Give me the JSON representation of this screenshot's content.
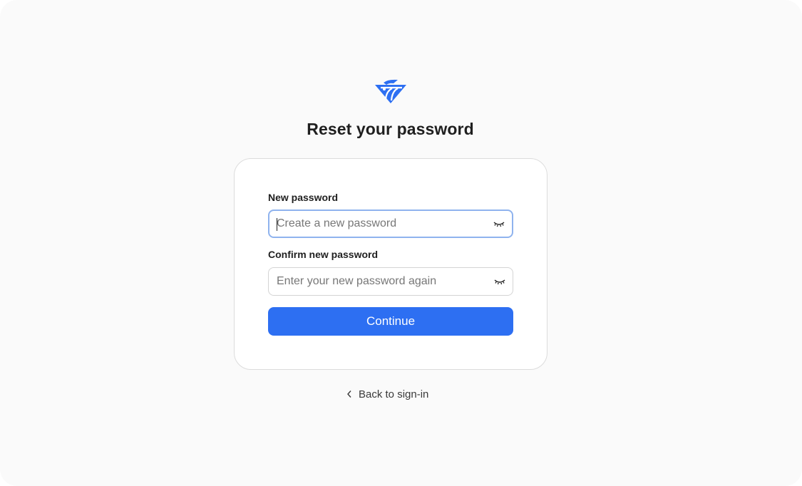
{
  "brand": {
    "logo_icon": "bird-logo-icon",
    "color": "#2d6ff2"
  },
  "page": {
    "title": "Reset your password"
  },
  "form": {
    "new_password": {
      "label": "New password",
      "placeholder": "Create a new password",
      "value": "",
      "toggle_icon": "eye-closed-icon"
    },
    "confirm_password": {
      "label": "Confirm new password",
      "placeholder": "Enter your new password again",
      "value": "",
      "toggle_icon": "eye-closed-icon"
    },
    "submit_label": "Continue"
  },
  "footer": {
    "back_icon": "chevron-left-icon",
    "back_label": "Back to sign-in"
  },
  "colors": {
    "accent": "#2d6ff2",
    "focus_ring": "#8fb3ee",
    "background": "#fafafa"
  }
}
